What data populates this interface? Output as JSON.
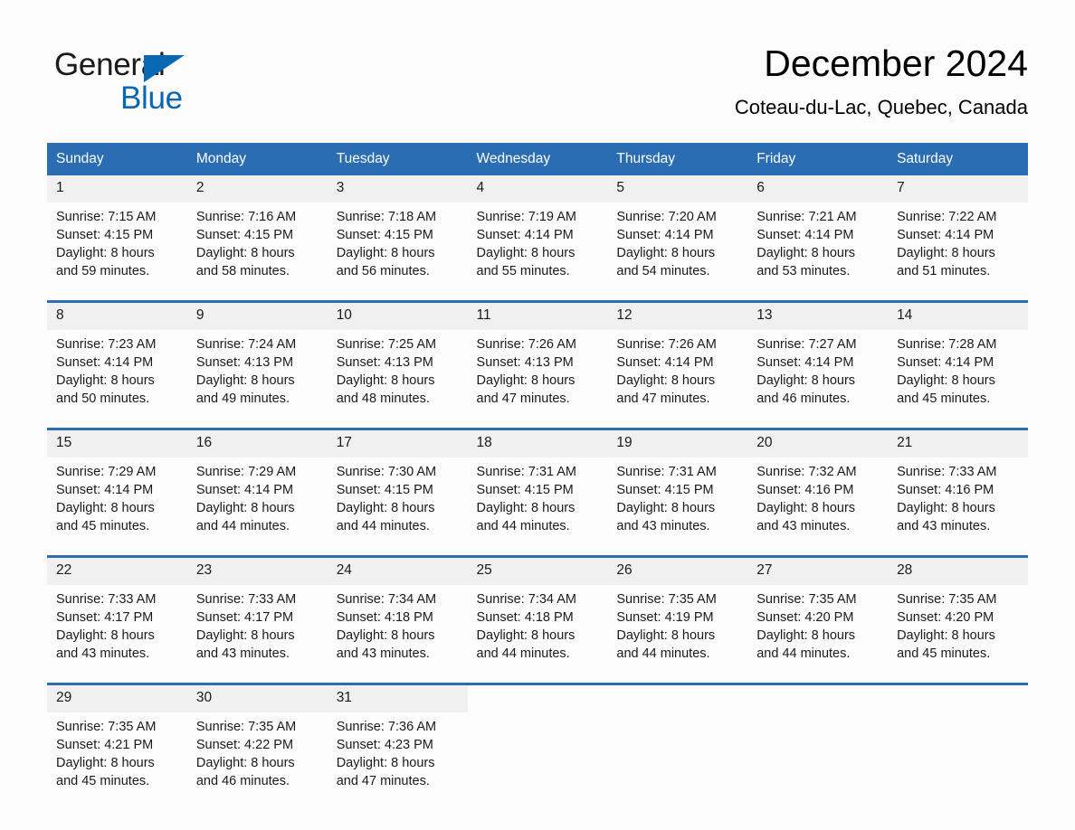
{
  "brand": {
    "name_part1": "General",
    "name_part2": "Blue",
    "logo_icon": "triangle-logo-icon",
    "accent_color": "#0a67b4"
  },
  "header": {
    "title": "December 2024",
    "location": "Coteau-du-Lac, Quebec, Canada"
  },
  "theme": {
    "header_blue": "#2a6db3",
    "date_row_gray": "#f0f0f0",
    "page_background": "#fcfcfc"
  },
  "calendar": {
    "weekday_headers": [
      "Sunday",
      "Monday",
      "Tuesday",
      "Wednesday",
      "Thursday",
      "Friday",
      "Saturday"
    ],
    "weeks": [
      {
        "days": [
          {
            "date": "1",
            "sunrise": "Sunrise: 7:15 AM",
            "sunset": "Sunset: 4:15 PM",
            "daylight_line1": "Daylight: 8 hours",
            "daylight_line2": "and 59 minutes."
          },
          {
            "date": "2",
            "sunrise": "Sunrise: 7:16 AM",
            "sunset": "Sunset: 4:15 PM",
            "daylight_line1": "Daylight: 8 hours",
            "daylight_line2": "and 58 minutes."
          },
          {
            "date": "3",
            "sunrise": "Sunrise: 7:18 AM",
            "sunset": "Sunset: 4:15 PM",
            "daylight_line1": "Daylight: 8 hours",
            "daylight_line2": "and 56 minutes."
          },
          {
            "date": "4",
            "sunrise": "Sunrise: 7:19 AM",
            "sunset": "Sunset: 4:14 PM",
            "daylight_line1": "Daylight: 8 hours",
            "daylight_line2": "and 55 minutes."
          },
          {
            "date": "5",
            "sunrise": "Sunrise: 7:20 AM",
            "sunset": "Sunset: 4:14 PM",
            "daylight_line1": "Daylight: 8 hours",
            "daylight_line2": "and 54 minutes."
          },
          {
            "date": "6",
            "sunrise": "Sunrise: 7:21 AM",
            "sunset": "Sunset: 4:14 PM",
            "daylight_line1": "Daylight: 8 hours",
            "daylight_line2": "and 53 minutes."
          },
          {
            "date": "7",
            "sunrise": "Sunrise: 7:22 AM",
            "sunset": "Sunset: 4:14 PM",
            "daylight_line1": "Daylight: 8 hours",
            "daylight_line2": "and 51 minutes."
          }
        ]
      },
      {
        "days": [
          {
            "date": "8",
            "sunrise": "Sunrise: 7:23 AM",
            "sunset": "Sunset: 4:14 PM",
            "daylight_line1": "Daylight: 8 hours",
            "daylight_line2": "and 50 minutes."
          },
          {
            "date": "9",
            "sunrise": "Sunrise: 7:24 AM",
            "sunset": "Sunset: 4:13 PM",
            "daylight_line1": "Daylight: 8 hours",
            "daylight_line2": "and 49 minutes."
          },
          {
            "date": "10",
            "sunrise": "Sunrise: 7:25 AM",
            "sunset": "Sunset: 4:13 PM",
            "daylight_line1": "Daylight: 8 hours",
            "daylight_line2": "and 48 minutes."
          },
          {
            "date": "11",
            "sunrise": "Sunrise: 7:26 AM",
            "sunset": "Sunset: 4:13 PM",
            "daylight_line1": "Daylight: 8 hours",
            "daylight_line2": "and 47 minutes."
          },
          {
            "date": "12",
            "sunrise": "Sunrise: 7:26 AM",
            "sunset": "Sunset: 4:14 PM",
            "daylight_line1": "Daylight: 8 hours",
            "daylight_line2": "and 47 minutes."
          },
          {
            "date": "13",
            "sunrise": "Sunrise: 7:27 AM",
            "sunset": "Sunset: 4:14 PM",
            "daylight_line1": "Daylight: 8 hours",
            "daylight_line2": "and 46 minutes."
          },
          {
            "date": "14",
            "sunrise": "Sunrise: 7:28 AM",
            "sunset": "Sunset: 4:14 PM",
            "daylight_line1": "Daylight: 8 hours",
            "daylight_line2": "and 45 minutes."
          }
        ]
      },
      {
        "days": [
          {
            "date": "15",
            "sunrise": "Sunrise: 7:29 AM",
            "sunset": "Sunset: 4:14 PM",
            "daylight_line1": "Daylight: 8 hours",
            "daylight_line2": "and 45 minutes."
          },
          {
            "date": "16",
            "sunrise": "Sunrise: 7:29 AM",
            "sunset": "Sunset: 4:14 PM",
            "daylight_line1": "Daylight: 8 hours",
            "daylight_line2": "and 44 minutes."
          },
          {
            "date": "17",
            "sunrise": "Sunrise: 7:30 AM",
            "sunset": "Sunset: 4:15 PM",
            "daylight_line1": "Daylight: 8 hours",
            "daylight_line2": "and 44 minutes."
          },
          {
            "date": "18",
            "sunrise": "Sunrise: 7:31 AM",
            "sunset": "Sunset: 4:15 PM",
            "daylight_line1": "Daylight: 8 hours",
            "daylight_line2": "and 44 minutes."
          },
          {
            "date": "19",
            "sunrise": "Sunrise: 7:31 AM",
            "sunset": "Sunset: 4:15 PM",
            "daylight_line1": "Daylight: 8 hours",
            "daylight_line2": "and 43 minutes."
          },
          {
            "date": "20",
            "sunrise": "Sunrise: 7:32 AM",
            "sunset": "Sunset: 4:16 PM",
            "daylight_line1": "Daylight: 8 hours",
            "daylight_line2": "and 43 minutes."
          },
          {
            "date": "21",
            "sunrise": "Sunrise: 7:33 AM",
            "sunset": "Sunset: 4:16 PM",
            "daylight_line1": "Daylight: 8 hours",
            "daylight_line2": "and 43 minutes."
          }
        ]
      },
      {
        "days": [
          {
            "date": "22",
            "sunrise": "Sunrise: 7:33 AM",
            "sunset": "Sunset: 4:17 PM",
            "daylight_line1": "Daylight: 8 hours",
            "daylight_line2": "and 43 minutes."
          },
          {
            "date": "23",
            "sunrise": "Sunrise: 7:33 AM",
            "sunset": "Sunset: 4:17 PM",
            "daylight_line1": "Daylight: 8 hours",
            "daylight_line2": "and 43 minutes."
          },
          {
            "date": "24",
            "sunrise": "Sunrise: 7:34 AM",
            "sunset": "Sunset: 4:18 PM",
            "daylight_line1": "Daylight: 8 hours",
            "daylight_line2": "and 43 minutes."
          },
          {
            "date": "25",
            "sunrise": "Sunrise: 7:34 AM",
            "sunset": "Sunset: 4:18 PM",
            "daylight_line1": "Daylight: 8 hours",
            "daylight_line2": "and 44 minutes."
          },
          {
            "date": "26",
            "sunrise": "Sunrise: 7:35 AM",
            "sunset": "Sunset: 4:19 PM",
            "daylight_line1": "Daylight: 8 hours",
            "daylight_line2": "and 44 minutes."
          },
          {
            "date": "27",
            "sunrise": "Sunrise: 7:35 AM",
            "sunset": "Sunset: 4:20 PM",
            "daylight_line1": "Daylight: 8 hours",
            "daylight_line2": "and 44 minutes."
          },
          {
            "date": "28",
            "sunrise": "Sunrise: 7:35 AM",
            "sunset": "Sunset: 4:20 PM",
            "daylight_line1": "Daylight: 8 hours",
            "daylight_line2": "and 45 minutes."
          }
        ]
      },
      {
        "days": [
          {
            "date": "29",
            "sunrise": "Sunrise: 7:35 AM",
            "sunset": "Sunset: 4:21 PM",
            "daylight_line1": "Daylight: 8 hours",
            "daylight_line2": "and 45 minutes."
          },
          {
            "date": "30",
            "sunrise": "Sunrise: 7:35 AM",
            "sunset": "Sunset: 4:22 PM",
            "daylight_line1": "Daylight: 8 hours",
            "daylight_line2": "and 46 minutes."
          },
          {
            "date": "31",
            "sunrise": "Sunrise: 7:36 AM",
            "sunset": "Sunset: 4:23 PM",
            "daylight_line1": "Daylight: 8 hours",
            "daylight_line2": "and 47 minutes."
          },
          {
            "date": "",
            "sunrise": "",
            "sunset": "",
            "daylight_line1": "",
            "daylight_line2": ""
          },
          {
            "date": "",
            "sunrise": "",
            "sunset": "",
            "daylight_line1": "",
            "daylight_line2": ""
          },
          {
            "date": "",
            "sunrise": "",
            "sunset": "",
            "daylight_line1": "",
            "daylight_line2": ""
          },
          {
            "date": "",
            "sunrise": "",
            "sunset": "",
            "daylight_line1": "",
            "daylight_line2": ""
          }
        ]
      }
    ]
  }
}
